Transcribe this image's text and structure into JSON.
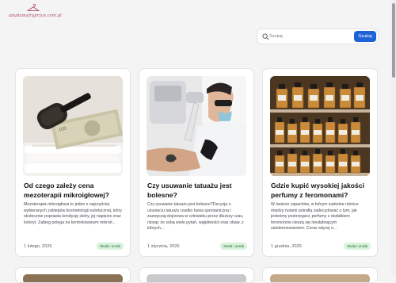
{
  "site": {
    "logo_text": "abudamafryprzus.com.pl",
    "logo_icon": "hanger-icon"
  },
  "search": {
    "placeholder": "Szukaj",
    "button_label": "Szukaj",
    "icon": "search-icon",
    "button_color": "#1e63d6"
  },
  "articles": [
    {
      "title": "Od czego zależy cena mezoterapii mikroigłowej?",
      "excerpt": "Mezoterapia mikroigłowa to jeden z najczęściej wybieranych zabiegów kosmetologii estetycznej, który skutecznie poprawia kondycję skóry, jej napięcie oraz koloryt. Zabieg polega na kontrolowanym mikrori...",
      "date": "1 lutego, 2026",
      "category": "Moda i uroda"
    },
    {
      "title": "Czy usuwanie tatuażu jest bolesne?",
      "excerpt": "Czy usuwanie tatuażu jest bolesne?Decyzja o usunięciu tatuażu rzadko bywa spontaniczna i zazwyczaj dojrzewa w człowieku przez dłuższy czas, niosąc ze sobą wiele pytań, wątpliwości oraz obaw, z których...",
      "date": "1 stycznia, 2026",
      "category": "Moda i uroda"
    },
    {
      "title": "Gdzie kupić wysokiej jakości perfumy z feromonami?",
      "excerpt": "W świecie zapachów, w którym subtelne różnice między nutami potrafią zadecydować o tym, jak jesteśmy postrzegani, perfumy z dodatkiem feromonów cieszą się niesłabnącym zainteresowaniem. Coraz więcej o...",
      "date": "1 grudnia, 2025",
      "category": "Moda i uroda"
    }
  ],
  "colors": {
    "badge_bg": "#d8f2dc",
    "badge_text": "#1e6b2c",
    "logo": "#b2456b"
  }
}
